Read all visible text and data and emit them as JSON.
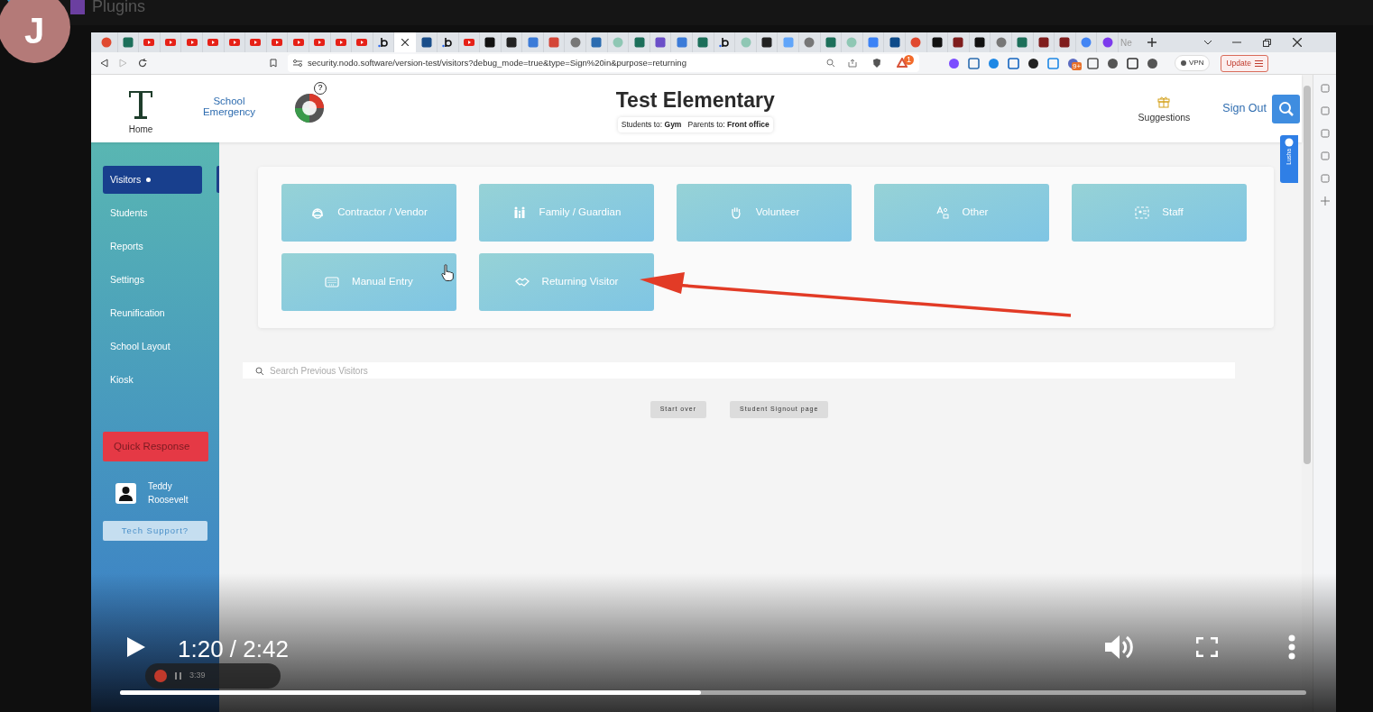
{
  "outer": {
    "plugins_label": "Plugins",
    "avatar_letter": "J"
  },
  "browser": {
    "partial_tab": "Ne",
    "url": "security.nodo.software/version-test/visitors?debug_mode=true&type=Sign%20in&purpose=returning",
    "alert_badge": "1",
    "extension_badge": "9+",
    "vpn": "VPN",
    "update": "Update"
  },
  "header": {
    "home": "Home",
    "emergency": "School Emergency",
    "help": "?",
    "title": "Test Elementary",
    "subtitle": "Students to: **Gym**   Parents to: **Front office**",
    "suggestions": "Suggestions",
    "sign_out": "Sign Out",
    "side_tab": "Lusha"
  },
  "sidebar": {
    "items": [
      {
        "label": "Visitors",
        "selected": true
      },
      {
        "label": "Students",
        "selected": false
      },
      {
        "label": "Reports",
        "selected": false
      },
      {
        "label": "Settings",
        "selected": false
      },
      {
        "label": "Reunification",
        "selected": false
      },
      {
        "label": "School Layout",
        "selected": false
      },
      {
        "label": "Kiosk",
        "selected": false
      }
    ],
    "quick_response": "Quick Response",
    "user": "Teddy Roosevelt",
    "tech_support": "Tech Support?"
  },
  "visitor_types": [
    {
      "label": "Contractor / Vendor",
      "kind": "helmet"
    },
    {
      "label": "Family / Guardian",
      "kind": "family"
    },
    {
      "label": "Volunteer",
      "kind": "hand"
    },
    {
      "label": "Other",
      "kind": "other"
    },
    {
      "label": "Staff",
      "kind": "staff"
    },
    {
      "label": "Manual Entry",
      "kind": "keyboard"
    },
    {
      "label": "Returning Visitor",
      "kind": "handshake"
    }
  ],
  "search": {
    "placeholder": "Search Previous Visitors"
  },
  "actions": [
    "Start over",
    "Student Signout page"
  ],
  "recorder": {
    "time": "3:39"
  },
  "video": {
    "time": "1:20 / 2:42",
    "level": 0.49
  }
}
